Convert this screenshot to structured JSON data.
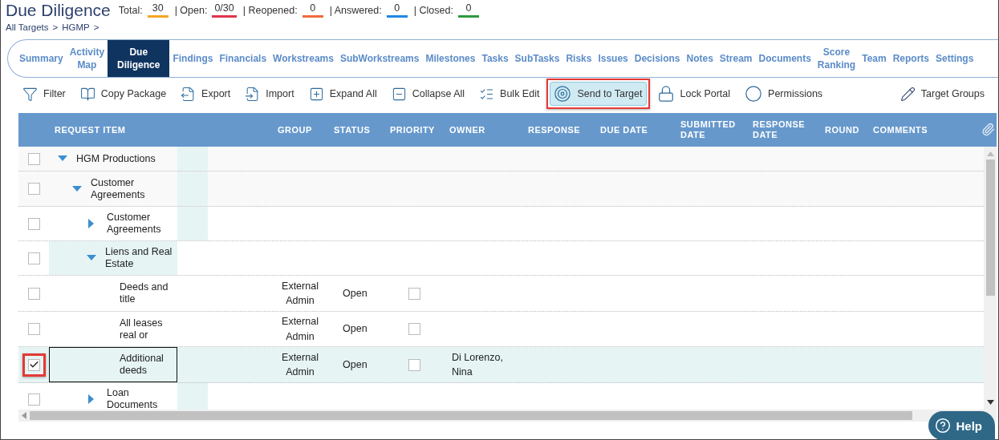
{
  "header": {
    "title": "Due Diligence",
    "stats": [
      {
        "label": "Total:",
        "value": "30",
        "color": "#f5a623"
      },
      {
        "label": "| Open:",
        "value": "0/30",
        "color": "#e0344f"
      },
      {
        "label": "| Reopened:",
        "value": "0",
        "color": "#f06a3c"
      },
      {
        "label": "| Answered:",
        "value": "0",
        "color": "#1e88e5"
      },
      {
        "label": "| Closed:",
        "value": "0",
        "color": "#2e9a3e"
      }
    ],
    "breadcrumb": [
      "All Targets",
      ">",
      "HGMP",
      ">"
    ]
  },
  "tabs": [
    {
      "label": "Summary",
      "selected": false
    },
    {
      "label": "Activity\nMap",
      "selected": false
    },
    {
      "label": "Due\nDiligence",
      "selected": true
    },
    {
      "label": "Findings",
      "selected": false
    },
    {
      "label": "Financials",
      "selected": false
    },
    {
      "label": "Workstreams",
      "selected": false
    },
    {
      "label": "SubWorkstreams",
      "selected": false
    },
    {
      "label": "Milestones",
      "selected": false
    },
    {
      "label": "Tasks",
      "selected": false
    },
    {
      "label": "SubTasks",
      "selected": false
    },
    {
      "label": "Risks",
      "selected": false
    },
    {
      "label": "Issues",
      "selected": false
    },
    {
      "label": "Decisions",
      "selected": false
    },
    {
      "label": "Notes",
      "selected": false
    },
    {
      "label": "Stream",
      "selected": false
    },
    {
      "label": "Documents",
      "selected": false
    },
    {
      "label": "Score\nRanking",
      "selected": false
    },
    {
      "label": "Team",
      "selected": false
    },
    {
      "label": "Reports",
      "selected": false
    },
    {
      "label": "Settings",
      "selected": false
    }
  ],
  "toolbar": [
    {
      "label": "Filter",
      "active": false,
      "highlighted": false
    },
    {
      "label": "Copy Package",
      "active": false,
      "highlighted": false
    },
    {
      "label": "Export",
      "active": false,
      "highlighted": false
    },
    {
      "label": "Import",
      "active": false,
      "highlighted": false
    },
    {
      "label": "Expand All",
      "active": false,
      "highlighted": false
    },
    {
      "label": "Collapse All",
      "active": false,
      "highlighted": false
    },
    {
      "label": "Bulk Edit",
      "active": false,
      "highlighted": false
    },
    {
      "label": "Send to Target",
      "active": true,
      "highlighted": true
    },
    {
      "label": "Lock Portal",
      "active": false,
      "highlighted": false
    },
    {
      "label": "Permissions",
      "active": false,
      "highlighted": false
    },
    {
      "label": "Target Groups",
      "active": false,
      "highlighted": false
    }
  ],
  "table": {
    "columns": [
      "REQUEST ITEM",
      "GROUP",
      "STATUS",
      "PRIORITY",
      "OWNER",
      "RESPONSE",
      "DUE DATE",
      "SUBMITTED DATE",
      "RESPONSE DATE",
      "ROUND",
      "COMMENTS"
    ],
    "rows": [
      {
        "item": "HGM Productions",
        "expanded": true,
        "checked": false,
        "selected": false,
        "highlighted": false,
        "children": [
          {
            "item": "Customer Agreements",
            "expanded": true,
            "checked": false,
            "selected": false,
            "highlighted": false,
            "children": [
              {
                "item": "Customer Agreements",
                "expanded": false,
                "checked": false,
                "selected": false,
                "highlighted": false
              },
              {
                "item": "Liens and Real Estate",
                "expanded": true,
                "checked": false,
                "selected": false,
                "highlighted": false,
                "active": true,
                "children": [
                  {
                    "item": "Deeds and title",
                    "group": "External Admin",
                    "status": "Open",
                    "priority": false,
                    "checked": false,
                    "selected": false,
                    "highlighted": false
                  },
                  {
                    "item": "All leases real or",
                    "group": "External Admin",
                    "status": "Open",
                    "priority": false,
                    "checked": false,
                    "selected": false,
                    "highlighted": false
                  },
                  {
                    "item": "Additional deeds",
                    "group": "External Admin",
                    "status": "Open",
                    "priority": false,
                    "owner": "Di Lorenzo, Nina",
                    "checked": true,
                    "selected": true,
                    "highlighted": true
                  }
                ]
              },
              {
                "item": "Loan Documents",
                "expanded": false,
                "checked": false,
                "selected": false,
                "highlighted": false
              }
            ]
          }
        ]
      }
    ]
  },
  "help": {
    "label": "Help"
  }
}
